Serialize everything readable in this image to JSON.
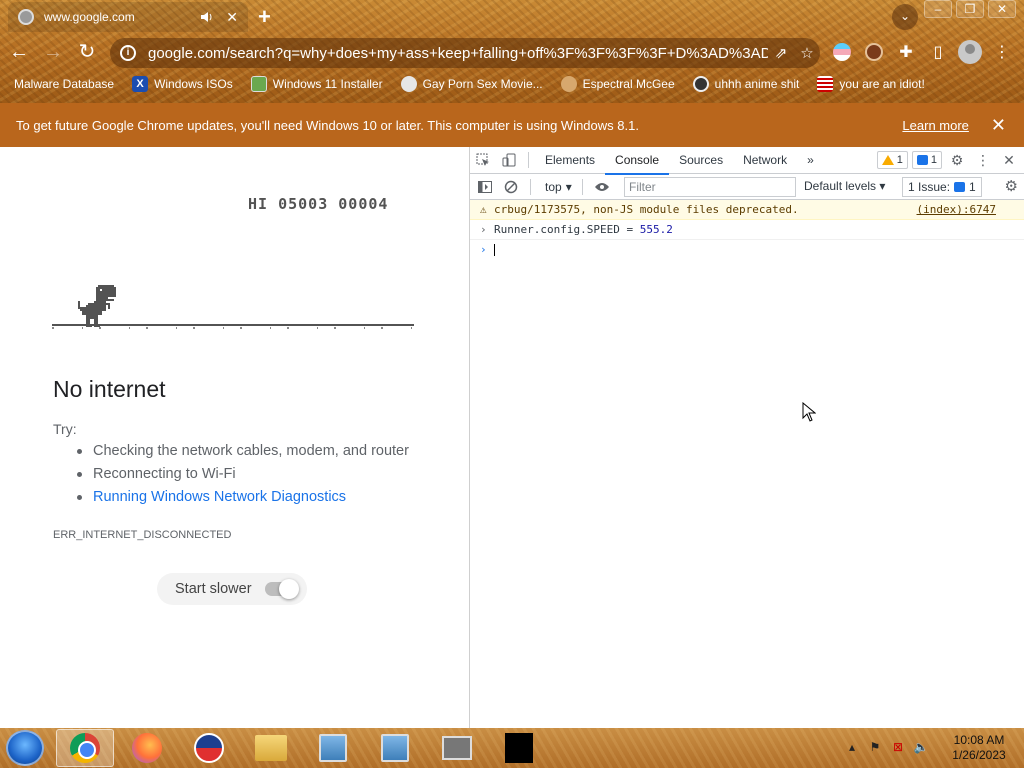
{
  "browser": {
    "tab": {
      "title": "www.google.com"
    },
    "address": {
      "url": "google.com/search?q=why+does+my+ass+keep+falling+off%3F%3F%3F%3F+D%3AD%3AD%..."
    },
    "bookmarks": [
      {
        "label": "Malware Database",
        "icon": "none"
      },
      {
        "label": "Windows ISOs",
        "icon": "x"
      },
      {
        "label": "Windows 11 Installer",
        "icon": "img"
      },
      {
        "label": "Gay Porn Sex Movie...",
        "icon": "gear"
      },
      {
        "label": "Espectral McGee",
        "icon": "face"
      },
      {
        "label": "uhhh anime shit",
        "icon": "anime"
      },
      {
        "label": "you are an idiot!",
        "icon": "flag"
      }
    ],
    "banner": {
      "message": "To get future Google Chrome updates, you'll need Windows 10 or later. This computer is using Windows 8.1.",
      "link": "Learn more"
    }
  },
  "page": {
    "hiscore": "HI 05003 00004",
    "heading": "No internet",
    "try_label": "Try:",
    "suggestions": [
      "Checking the network cables, modem, and router",
      "Reconnecting to Wi-Fi",
      "Running Windows Network Diagnostics"
    ],
    "error_code": "ERR_INTERNET_DISCONNECTED",
    "start_slower": "Start slower",
    "start_slower_on": true
  },
  "devtools": {
    "tabs": [
      "Elements",
      "Console",
      "Sources",
      "Network"
    ],
    "active_tab": "Console",
    "more_tabs": "»",
    "warnings_count": "1",
    "messages_count": "1",
    "context": "top",
    "filter_placeholder": "Filter",
    "levels": "Default levels",
    "issues_label": "1 Issue:",
    "issues_count": "1",
    "console": [
      {
        "type": "warning",
        "text": "crbug/1173575, non-JS module files deprecated.",
        "source": "(index):6747"
      },
      {
        "type": "input",
        "code": "Runner.config.SPEED = ",
        "value": "555.2"
      }
    ]
  },
  "taskbar": {
    "time": "10:08 AM",
    "date": "1/26/2023"
  }
}
